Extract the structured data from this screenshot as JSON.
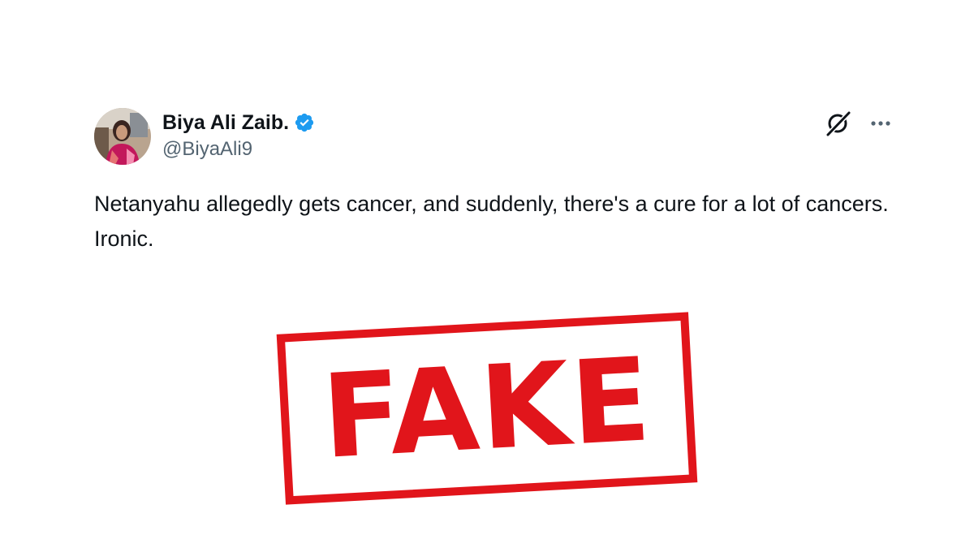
{
  "tweet": {
    "author": {
      "display_name": "Biya Ali Zaib.",
      "handle": "@BiyaAli9",
      "verified": true,
      "verified_color": "#1d9bf0"
    },
    "text": "Netanyahu allegedly gets cancer, and suddenly, there's a cure for a lot of cancers. Ironic.",
    "actions": {
      "grok_icon": "grok-icon",
      "more_icon": "more-options-icon"
    }
  },
  "stamp": {
    "label": "FAKE",
    "color": "#e1151b"
  }
}
